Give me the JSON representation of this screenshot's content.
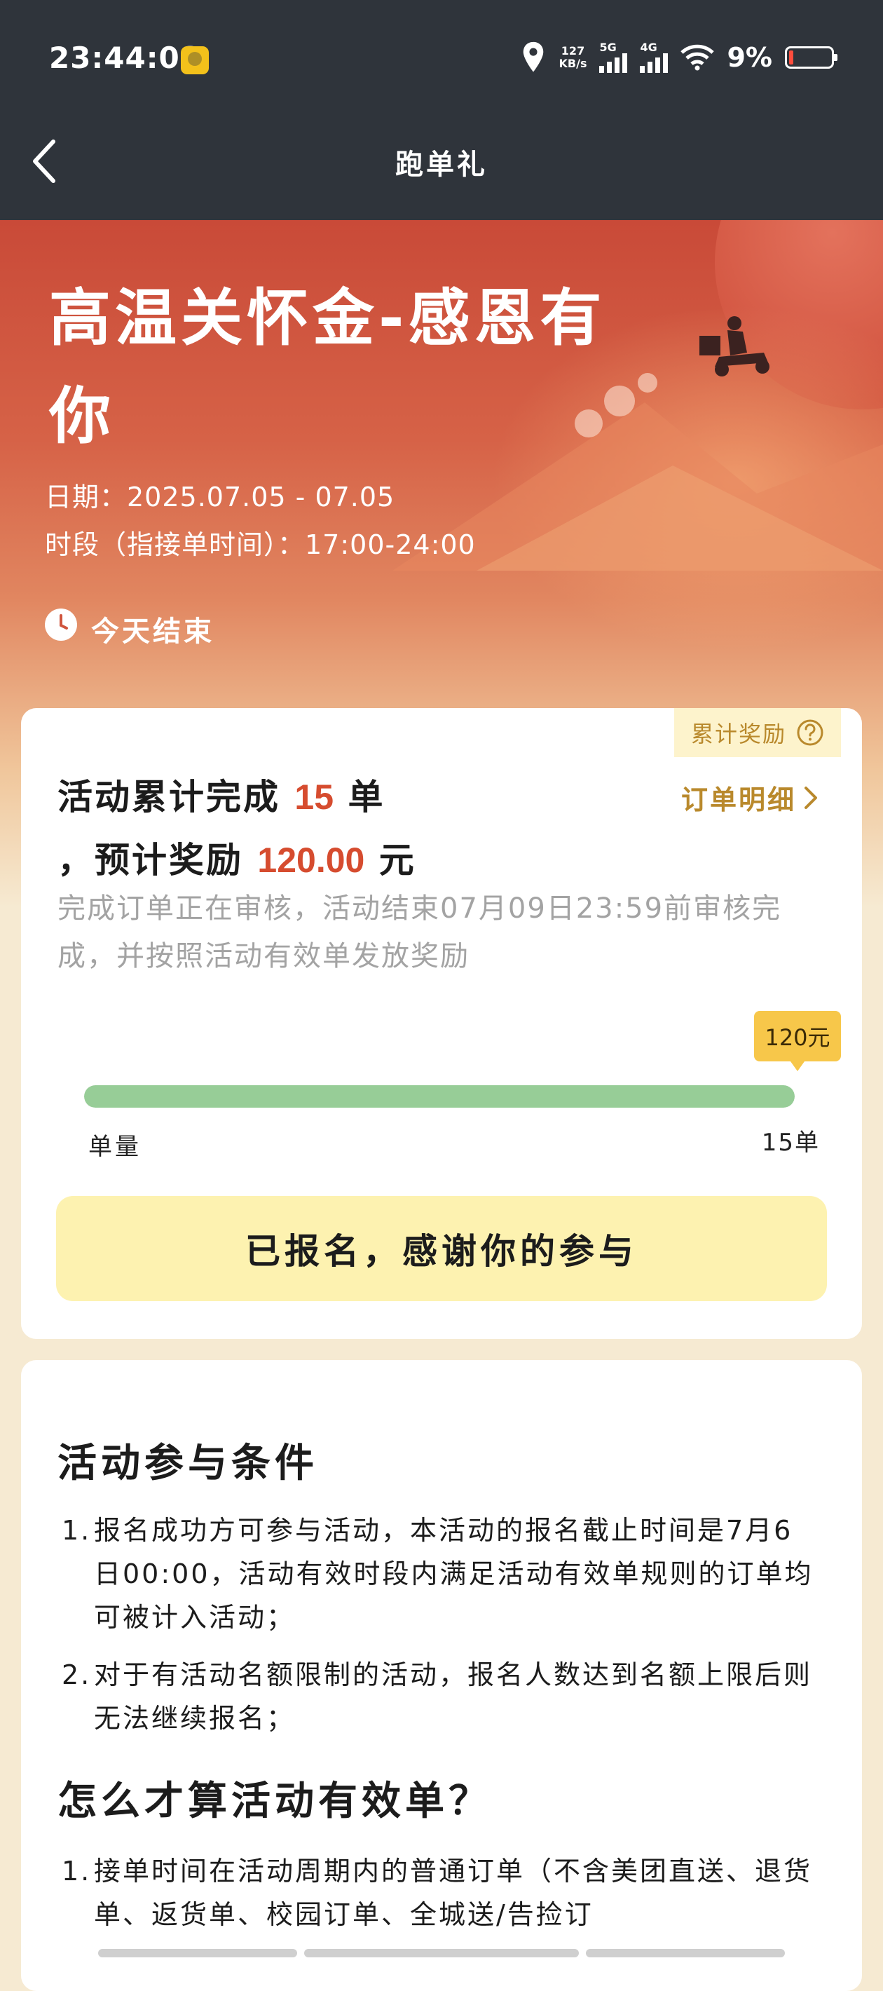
{
  "status_bar": {
    "time": "23:44:08",
    "net_speed_value": "127",
    "net_speed_unit": "KB/s",
    "sim1_label": "5G",
    "sim2_label": "4G",
    "battery": "9%",
    "battery_color": "#ff4d3d"
  },
  "nav": {
    "title": "跑单礼",
    "back_icon": "chevron-left-icon"
  },
  "hero": {
    "title": "高温关怀金-感恩有你",
    "date": "日期：2025.07.05 - 07.05",
    "period": "时段（指接单时间）：17:00-24:00",
    "ends_text": "今天结束"
  },
  "summary_card": {
    "reward_tag": "累计奖励",
    "line1_prefix": "活动累计完成",
    "orders": "15",
    "line1_suffix": "单",
    "line2_prefix": "，预计奖励",
    "amount": "120.00",
    "line2_suffix": "元",
    "detail_link": "订单明细",
    "review_note": "完成订单正在审核，活动结束07月09日23:59前审核完成，并按照活动有效单发放奖励",
    "progress": {
      "bubble": "120元",
      "fraction": 1.0,
      "left_label": "单量",
      "right_label": "15单",
      "fill_color": "#97cd97"
    },
    "signup_button": "已报名，感谢你的参与"
  },
  "rules_card": {
    "conditions_title": "活动参与条件",
    "conditions": [
      {
        "num": "1.",
        "text": "报名成功方可参与活动，本活动的报名截止时间是7月6日00:00，活动有效时段内满足活动有效单规则的订单均可被计入活动；"
      },
      {
        "num": "2.",
        "text": "对于有活动名额限制的活动，报名人数达到名额上限后则无法继续报名；"
      }
    ],
    "valid_title": "怎么才算活动有效单？",
    "valid_rules": [
      {
        "num": "1.",
        "text": "接单时间在活动周期内的普通订单（不含美团直送、退货单、返货单、校园订单、全城送/告捡订"
      }
    ]
  },
  "colors": {
    "header_bg": "#2f343b",
    "highlight": "#d64c2f",
    "gold": "#b9892c"
  }
}
